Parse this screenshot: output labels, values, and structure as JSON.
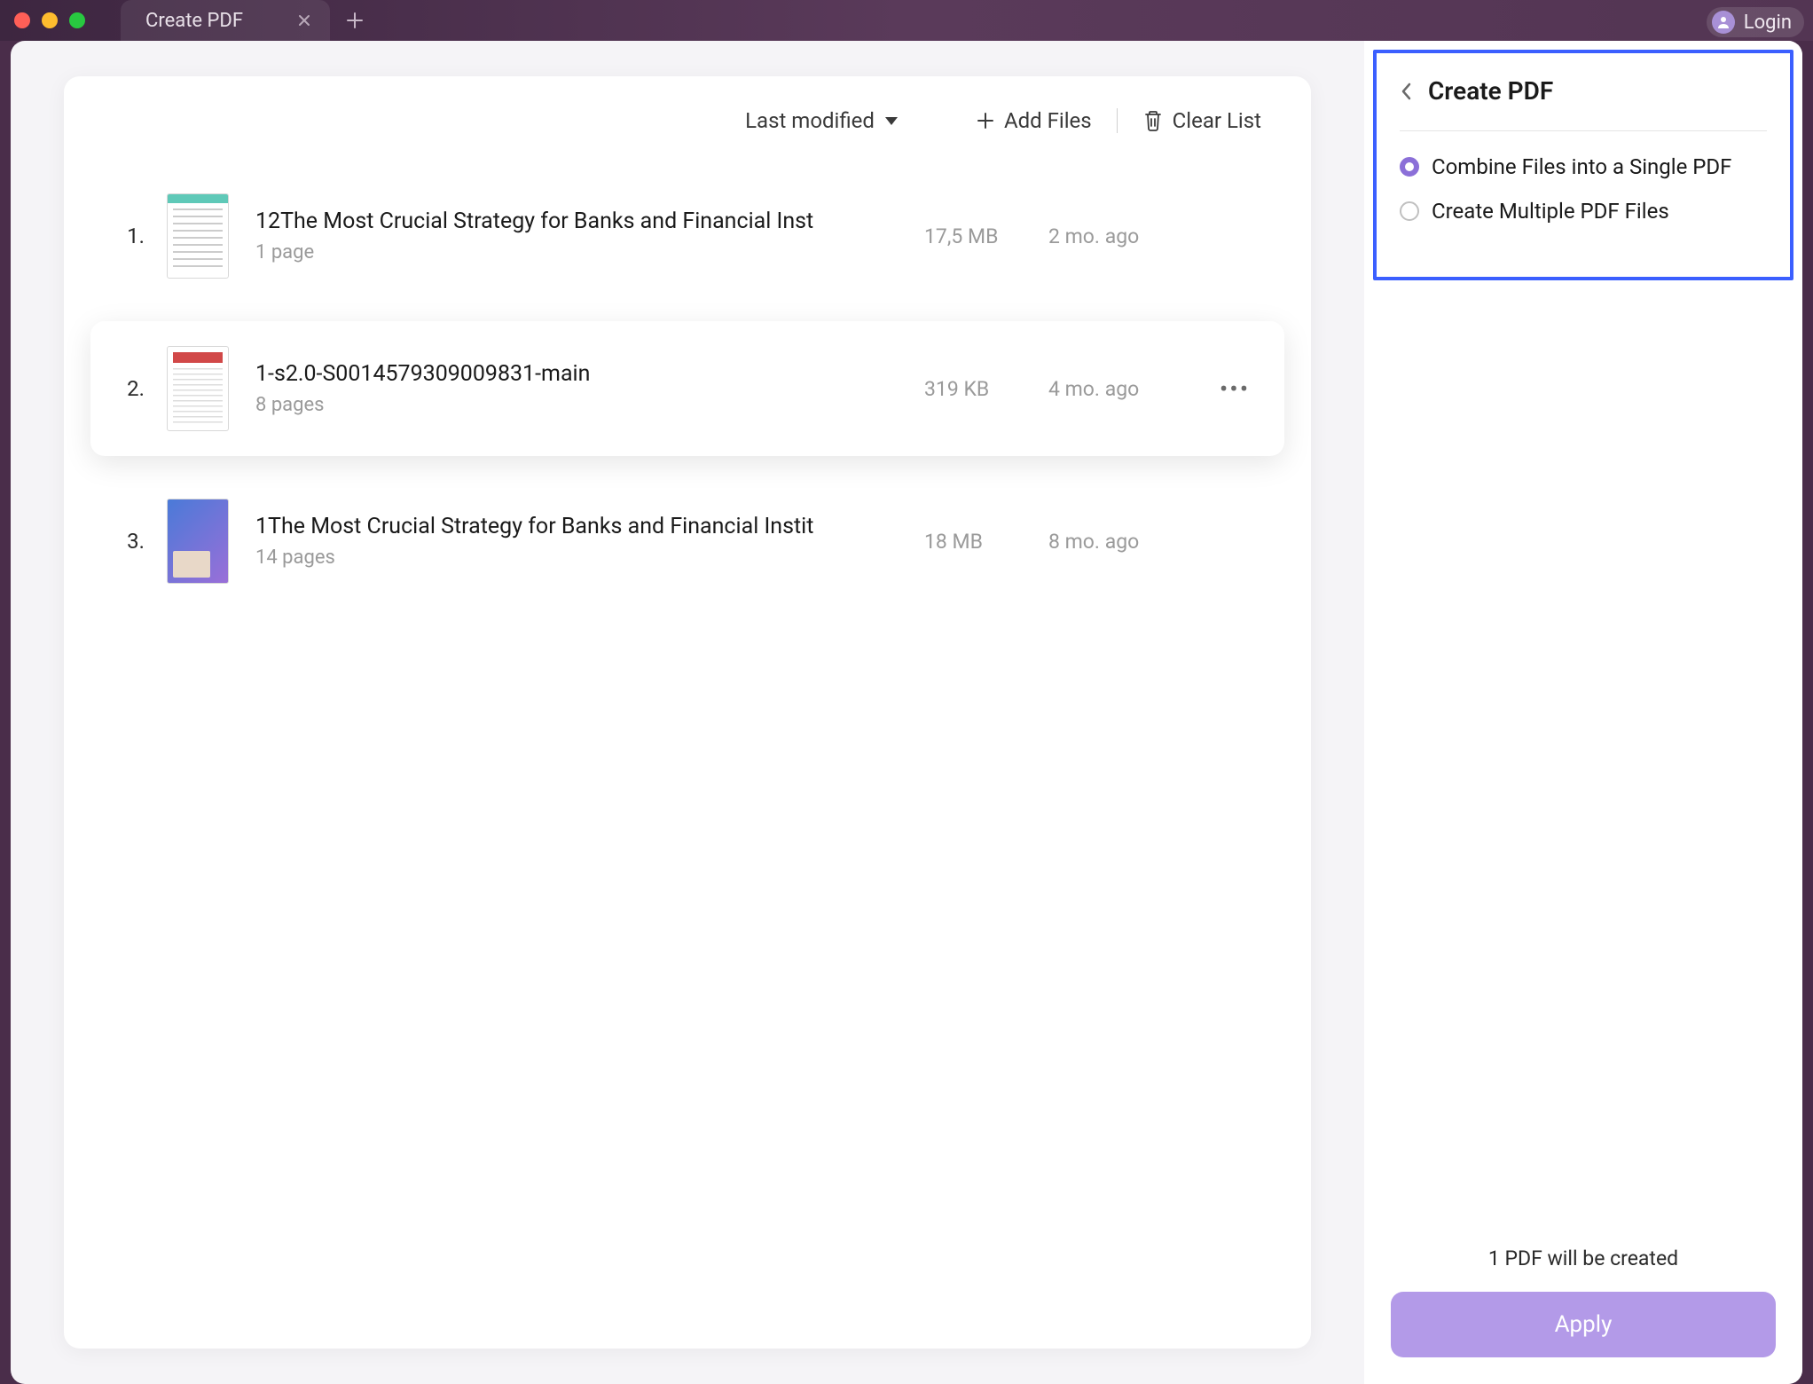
{
  "tab": {
    "title": "Create PDF"
  },
  "login": {
    "label": "Login"
  },
  "toolbar": {
    "sort_label": "Last modified",
    "add_files": "Add Files",
    "clear_list": "Clear List"
  },
  "files": [
    {
      "index": "1.",
      "name": "12The Most Crucial Strategy for Banks and Financial Inst",
      "pages": "1 page",
      "size": "17,5 MB",
      "date": "2 mo. ago"
    },
    {
      "index": "2.",
      "name": "1-s2.0-S0014579309009831-main",
      "pages": "8 pages",
      "size": "319 KB",
      "date": "4 mo. ago"
    },
    {
      "index": "3.",
      "name": "1The Most Crucial Strategy for Banks and Financial Instit",
      "pages": "14 pages",
      "size": "18 MB",
      "date": "8 mo. ago"
    }
  ],
  "side": {
    "title": "Create PDF",
    "option_combine": "Combine Files into a Single PDF",
    "option_multiple": "Create Multiple PDF Files",
    "status": "1 PDF will be created",
    "apply": "Apply"
  }
}
